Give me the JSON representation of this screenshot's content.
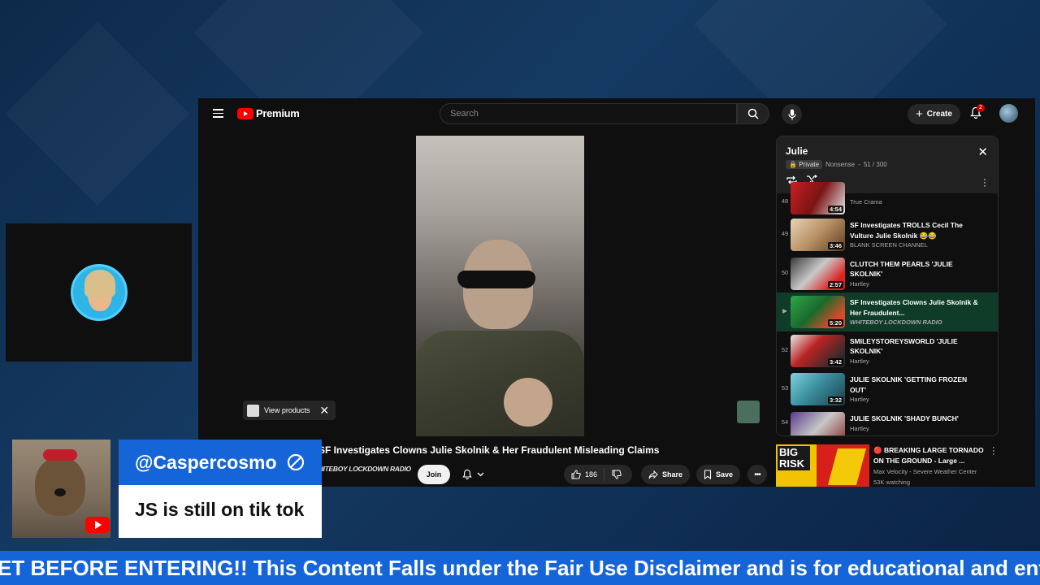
{
  "app": {
    "logo_text": "Premium",
    "search_placeholder": "Search",
    "create_label": "Create",
    "notification_count": "2"
  },
  "video": {
    "title": "SF Investigates Clowns Julie Skolnik & Her Fraudulent Misleading Claims",
    "channel": "WHITEBOY LOCKDOWN RADIO",
    "view_products_label": "View products",
    "join_label": "Join",
    "like_count": "186",
    "share_label": "Share",
    "save_label": "Save"
  },
  "playlist": {
    "title": "Julie",
    "private_label": "Private",
    "owner": "Nonsense",
    "position": "51 / 300",
    "items": [
      {
        "index": "48",
        "title": "",
        "channel": "True Crama",
        "duration": "4:54",
        "active": false
      },
      {
        "index": "49",
        "title": "SF Investigates TROLLS Cecil The Vulture Julie Skolnik 😂😂",
        "channel": "BLANK SCREEN CHANNEL",
        "duration": "3:46",
        "active": false
      },
      {
        "index": "50",
        "title": "CLUTCH THEM PEARLS 'JULIE SKOLNIK'",
        "channel": "Hartley",
        "duration": "2:57",
        "active": false
      },
      {
        "index": "▶",
        "title": "SF Investigates Clowns Julie Skolnik & Her Fraudulent...",
        "channel": "WHITEBOY LOCKDOWN RADIO",
        "duration": "5:20",
        "active": true
      },
      {
        "index": "52",
        "title": "SMILEYSTOREYSWORLD 'JULIE SKOLNIK'",
        "channel": "Hartley",
        "duration": "3:42",
        "active": false
      },
      {
        "index": "53",
        "title": "JULIE SKOLNIK 'GETTING FROZEN OUT'",
        "channel": "Hartley",
        "duration": "3:32",
        "active": false
      },
      {
        "index": "54",
        "title": "JULIE SKOLNIK 'SHADY BUNCH'",
        "channel": "Hartley",
        "duration": "",
        "active": false
      }
    ]
  },
  "recommendation": {
    "title": "🔴 BREAKING LARGE TORNADO ON THE GROUND - Large ...",
    "channel": "Max Velocity - Severe Weather Center",
    "watching": "53K watching",
    "thumb_text": "BIG RISK"
  },
  "chat": {
    "username": "@Caspercosmo",
    "message": "JS is still on tik tok"
  },
  "ticker": {
    "text": "ET BEFORE ENTERING!! This Content Falls under the Fair Use Disclaimer and is for educational and entertainment"
  },
  "colors": {
    "accent_blue": "#1565d8",
    "youtube_red": "#ff0000",
    "active_row": "#0f3b29"
  }
}
